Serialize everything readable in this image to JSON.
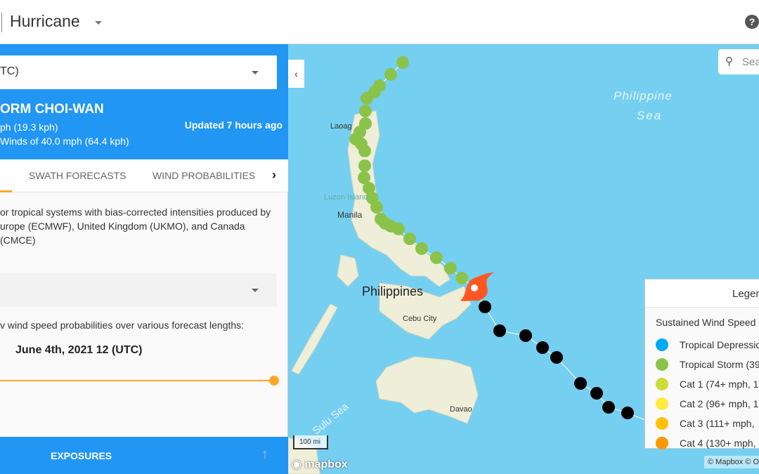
{
  "topbar": {
    "title": "Hurricane",
    "help_icon": "?"
  },
  "panel": {
    "forecast_select": "TC)",
    "storm_name": "ORM CHOI-WAN",
    "movement": "ph (19.3 kph)",
    "winds": "Winds of 40.0 mph (64.4 kph)",
    "updated": "Updated 7 hours ago",
    "tabs": [
      {
        "label": "SWATH FORECASTS"
      },
      {
        "label": "WIND PROBABILITIES"
      }
    ],
    "description_line1": "or tropical systems with bias-corrected intensities produced by",
    "description_line2": "urope (ECMWF), United Kingdom (UKMO), and Canada (CMCE)",
    "probabilities_text": "v wind speed probabilities over various forecast lengths:",
    "slider_date": "June 4th, 2021 12 (UTC)",
    "slider_value_percent": 100,
    "exposures": "EXPOSURES"
  },
  "map": {
    "search_placeholder": "Sea",
    "labels": {
      "sea": "Philippine",
      "sea2": "Sea",
      "laoag": "Laoag",
      "luzon": "Luzon Island",
      "manila": "Manila",
      "philippines": "Philippines",
      "cebu": "Cebu City",
      "sulu": "Sulu Sea",
      "davao": "Davao"
    },
    "scale": "100 mi",
    "mapbox": "mapbox",
    "attribution": "© Mapbox © O",
    "colors": {
      "ocean": "#75cff0",
      "land": "#efeed8",
      "hurricane": "#ff5722",
      "forecast_track": "#000000"
    },
    "legend": {
      "title": "Legen",
      "subtitle": "Sustained Wind Speed",
      "items": [
        {
          "label": "Tropical Depressio",
          "color": "#03a9f4"
        },
        {
          "label": "Tropical Storm (39",
          "color": "#8bc34a"
        },
        {
          "label": "Cat 1 (74+ mph, 1",
          "color": "#cddc39"
        },
        {
          "label": "Cat 2 (96+ mph, 1",
          "color": "#ffeb3b"
        },
        {
          "label": "Cat 3 (111+ mph,",
          "color": "#ffc107"
        },
        {
          "label": "Cat 4 (130+ mph,",
          "color": "#ff9800"
        }
      ]
    }
  }
}
